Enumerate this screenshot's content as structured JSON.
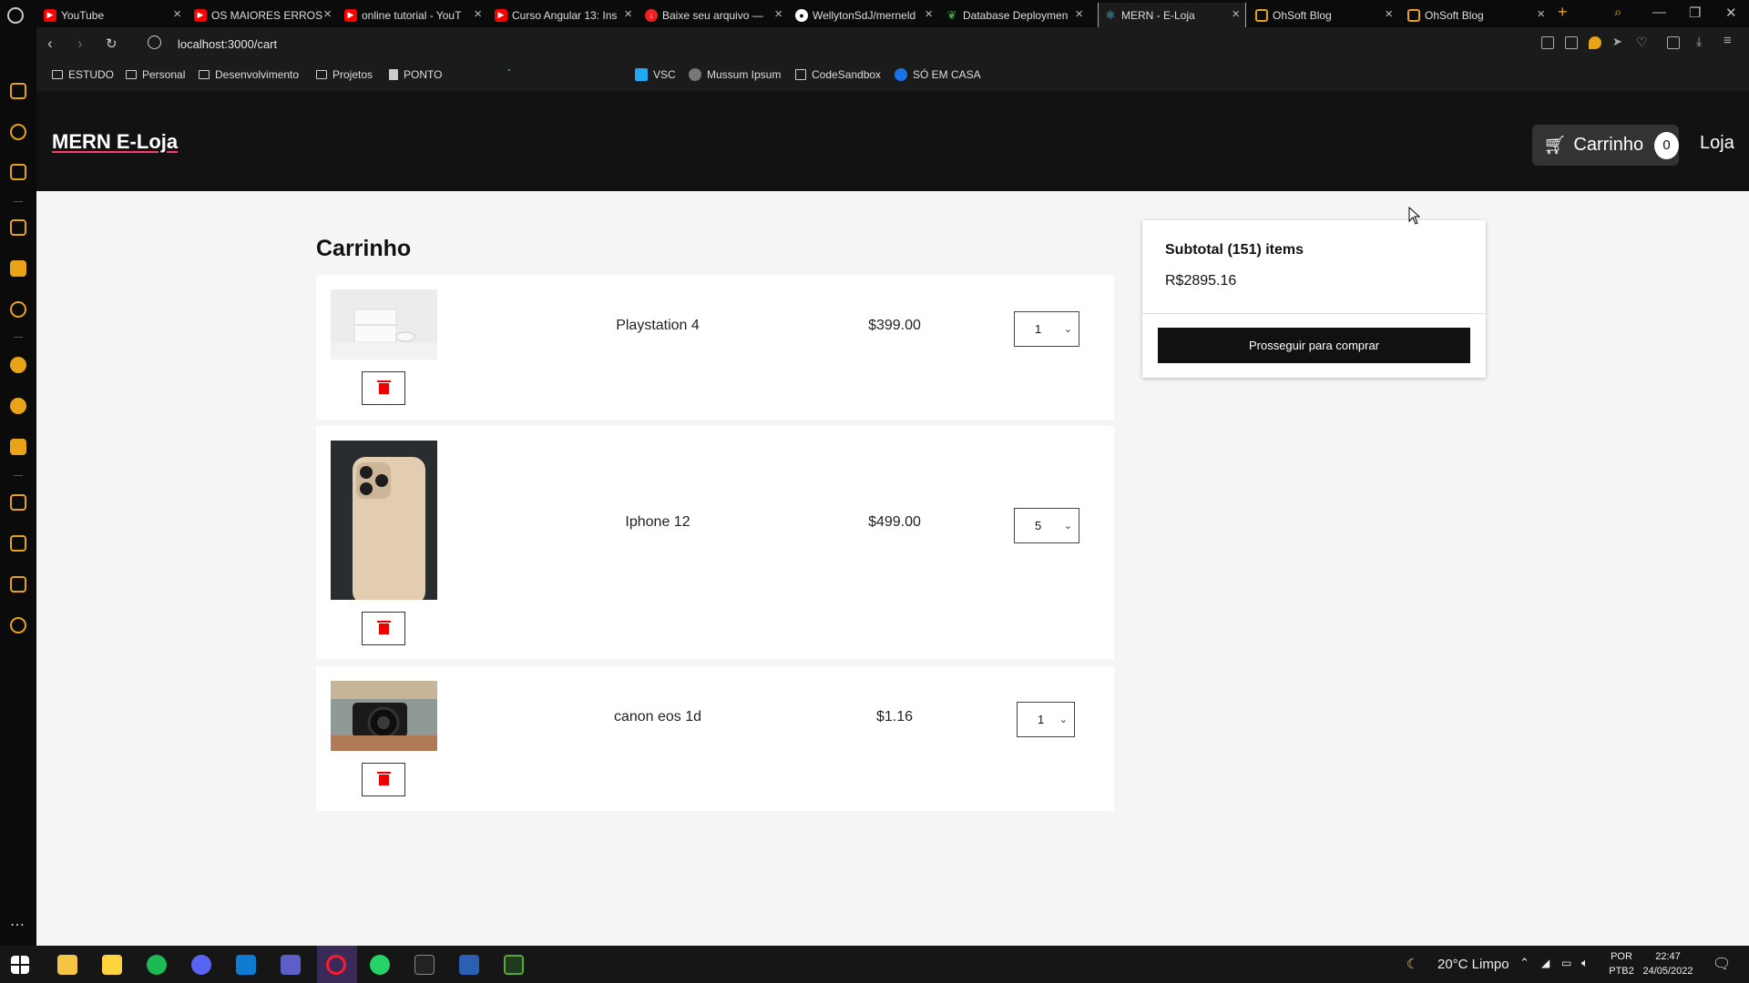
{
  "browser": {
    "tabs": [
      {
        "label": "YouTube",
        "icon": "youtube-icon"
      },
      {
        "label": "OS MAIORES ERROS",
        "icon": "youtube-icon"
      },
      {
        "label": "online tutorial - YouT",
        "icon": "youtube-icon"
      },
      {
        "label": "Curso Angular 13: Ins",
        "icon": "youtube-icon"
      },
      {
        "label": "Baixe seu arquivo —",
        "icon": "download-icon"
      },
      {
        "label": "WellytonSdJ/merneld",
        "icon": "github-icon"
      },
      {
        "label": "Database Deploymen",
        "icon": "mongodb-icon"
      },
      {
        "label": "MERN - E-Loja",
        "icon": "react-icon"
      },
      {
        "label": "OhSoft Blog",
        "icon": "blog-icon"
      },
      {
        "label": "OhSoft Blog",
        "icon": "blog-icon"
      }
    ],
    "url": "localhost:3000/cart",
    "bookmarks": [
      "ESTUDO",
      "Personal",
      "Desenvolvimento",
      "Projetos",
      "PONTO",
      "VSC",
      "Mussum Ipsum",
      "CodeSandbox",
      "SÓ EM CASA"
    ],
    "colors": {
      "accent": "#e8a317",
      "youtube": "#ff0000"
    }
  },
  "app": {
    "logo": "MERN E-Loja",
    "cart_label": "Carrinho",
    "cart_count": "0",
    "shop_label": "Loja"
  },
  "cart": {
    "title": "Carrinho",
    "items": [
      {
        "name": "Playstation 4",
        "price": "$399.00",
        "qty": "1"
      },
      {
        "name": "Iphone 12",
        "price": "$499.00",
        "qty": "5"
      },
      {
        "name": "canon eos 1d",
        "price": "$1.16",
        "qty": "1"
      }
    ]
  },
  "summary": {
    "title": "Subtotal (151) items",
    "value": "R$2895.16",
    "checkout_label": "Prosseguir para comprar"
  },
  "taskbar": {
    "weather": "20°C  Limpo",
    "lang": "POR",
    "layout": "PTB2",
    "time": "22:47",
    "date": "24/05/2022"
  }
}
